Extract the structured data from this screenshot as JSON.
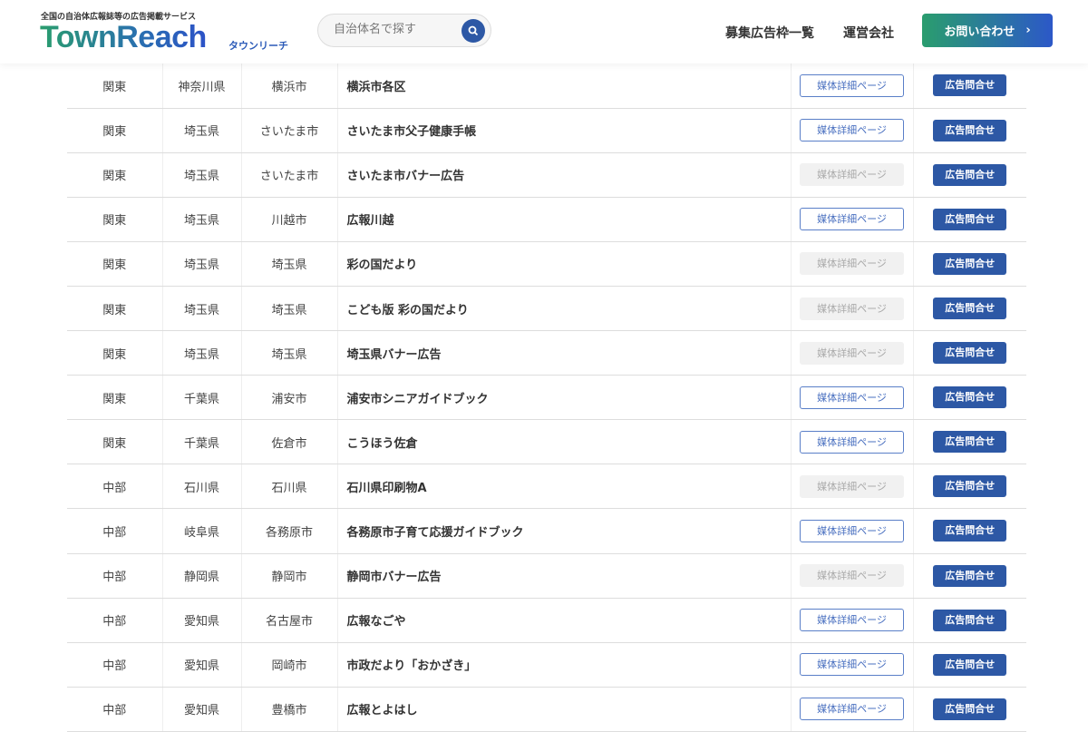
{
  "header": {
    "tagline": "全国の自治体広報誌等の広告掲載サービス",
    "logo": "TownReach",
    "logo_kana": "タウンリーチ",
    "search_placeholder": "自治体名で探す",
    "nav": [
      "募集広告枠一覧",
      "運営会社"
    ],
    "contact": "お問い合わせ",
    "contact_arrow": "›"
  },
  "buttons": {
    "detail": "媒体詳細ページ",
    "inquiry": "広告問合せ"
  },
  "rows": [
    {
      "region": "関東",
      "pref": "神奈川県",
      "city": "横浜市",
      "media": "横浜市各区",
      "detail_enabled": true
    },
    {
      "region": "関東",
      "pref": "埼玉県",
      "city": "さいたま市",
      "media": "さいたま市父子健康手帳",
      "detail_enabled": true
    },
    {
      "region": "関東",
      "pref": "埼玉県",
      "city": "さいたま市",
      "media": "さいたま市バナー広告",
      "detail_enabled": false
    },
    {
      "region": "関東",
      "pref": "埼玉県",
      "city": "川越市",
      "media": "広報川越",
      "detail_enabled": true
    },
    {
      "region": "関東",
      "pref": "埼玉県",
      "city": "埼玉県",
      "media": "彩の国だより",
      "detail_enabled": false
    },
    {
      "region": "関東",
      "pref": "埼玉県",
      "city": "埼玉県",
      "media": "こども版 彩の国だより",
      "detail_enabled": false
    },
    {
      "region": "関東",
      "pref": "埼玉県",
      "city": "埼玉県",
      "media": "埼玉県バナー広告",
      "detail_enabled": false
    },
    {
      "region": "関東",
      "pref": "千葉県",
      "city": "浦安市",
      "media": "浦安市シニアガイドブック",
      "detail_enabled": true
    },
    {
      "region": "関東",
      "pref": "千葉県",
      "city": "佐倉市",
      "media": "こうほう佐倉",
      "detail_enabled": true
    },
    {
      "region": "中部",
      "pref": "石川県",
      "city": "石川県",
      "media": "石川県印刷物A",
      "detail_enabled": false
    },
    {
      "region": "中部",
      "pref": "岐阜県",
      "city": "各務原市",
      "media": "各務原市子育て応援ガイドブック",
      "detail_enabled": true
    },
    {
      "region": "中部",
      "pref": "静岡県",
      "city": "静岡市",
      "media": "静岡市バナー広告",
      "detail_enabled": false
    },
    {
      "region": "中部",
      "pref": "愛知県",
      "city": "名古屋市",
      "media": "広報なごや",
      "detail_enabled": true
    },
    {
      "region": "中部",
      "pref": "愛知県",
      "city": "岡崎市",
      "media": "市政だより「おかざき」",
      "detail_enabled": true
    },
    {
      "region": "中部",
      "pref": "愛知県",
      "city": "豊橋市",
      "media": "広報とよはし",
      "detail_enabled": true
    }
  ]
}
